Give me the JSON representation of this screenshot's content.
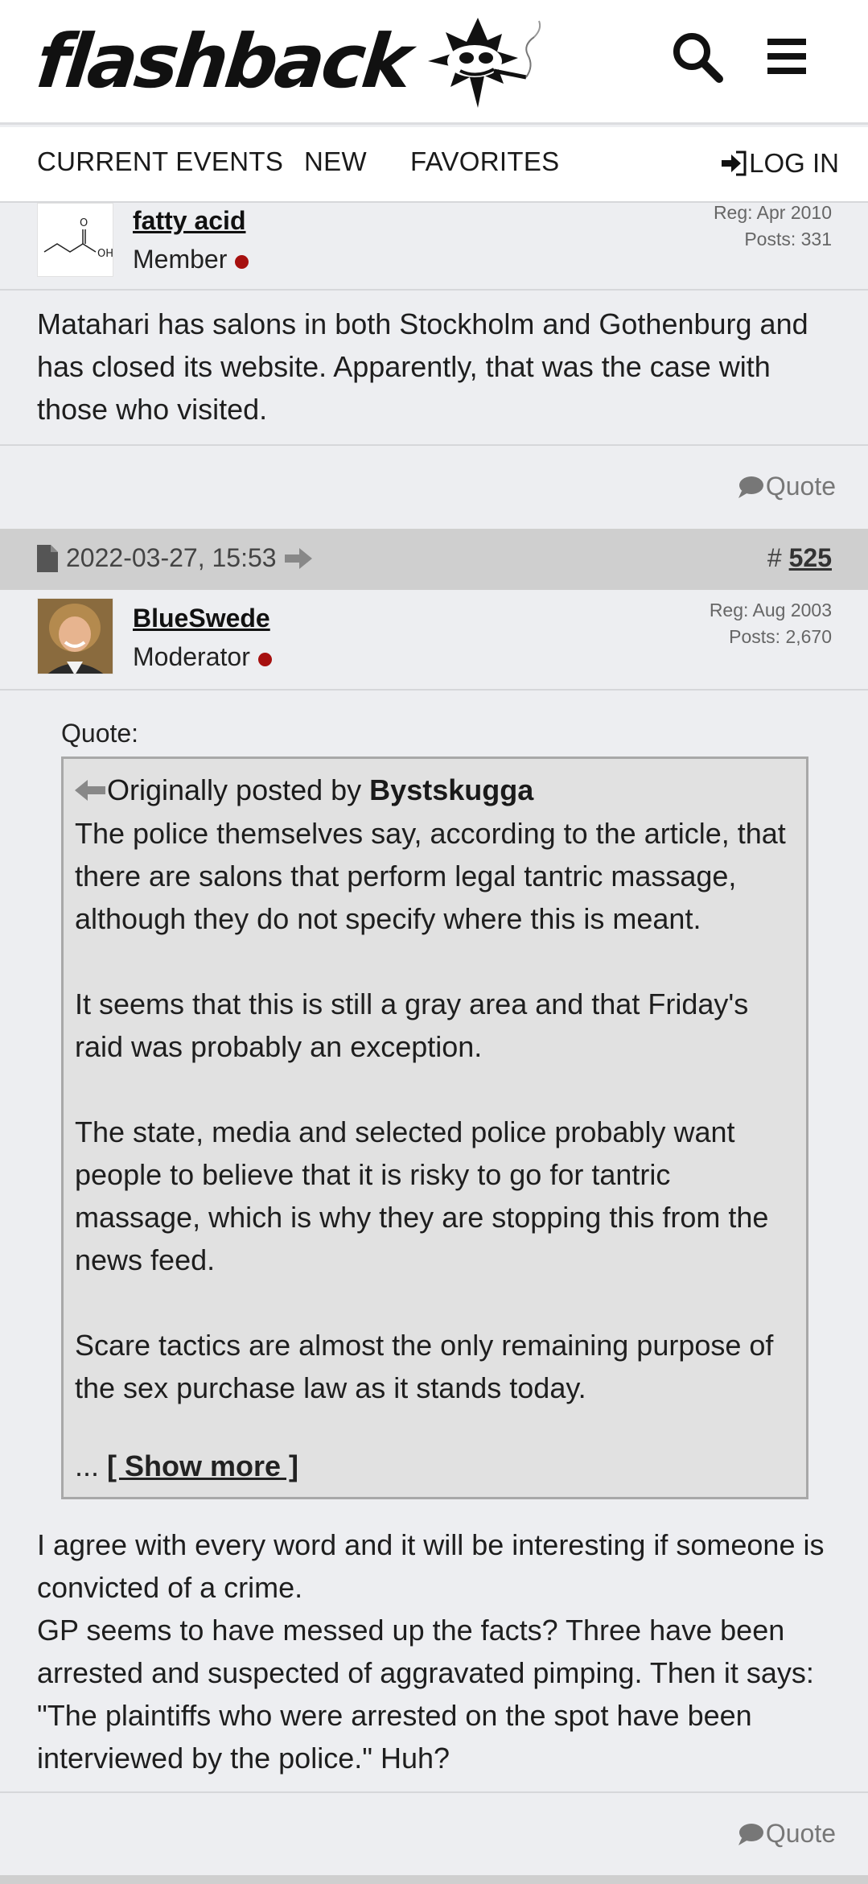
{
  "header": {
    "logo_text": "flashback",
    "search_icon": "search-icon",
    "menu_icon": "hamburger-menu-icon"
  },
  "nav": {
    "items": [
      "CURRENT EVENTS",
      "NEW",
      "FAVORITES"
    ],
    "login": "LOG IN"
  },
  "post1": {
    "username": "fatty acid",
    "role": "Member",
    "reg": "Reg: Apr 2010",
    "posts": "Posts: 331",
    "text": "Matahari has salons in both Stockholm and Gothenburg and has closed its website. Apparently, that was the case with those who visited.",
    "quote_label": "Quote"
  },
  "post2": {
    "date": "2022-03-27, 15:53",
    "number_prefix": "#",
    "number": "525",
    "username": "BlueSwede",
    "role": "Moderator",
    "reg": "Reg: Aug 2003",
    "posts": "Posts: 2,670",
    "quote": {
      "label": "Quote:",
      "origin_prefix": "Originally posted by",
      "origin_user": "Bystskugga",
      "paragraphs": [
        "The police themselves say, according to the article, that there are salons that perform legal tantric massage, although they do not specify where this is meant.",
        "It seems that this is still a gray area and that Friday's raid was probably an exception.",
        "The state, media and selected police probably want people to believe that it is risky to go for tantric massage, which is why they are stopping this from the news feed.",
        "Scare tactics are almost the only remaining purpose of the sex purchase law as it stands today."
      ],
      "ellipsis": "...",
      "show_more": "[ Show more ]"
    },
    "text_lines": [
      "I agree with every word and it will be interesting if someone is convicted of a crime.",
      "GP seems to have messed up the facts? Three have been arrested and suspected of aggravated pimping. Then it says: \"The plaintiffs who were arrested on the spot have been interviewed by the police.\" Huh?"
    ],
    "quote_label": "Quote"
  },
  "colors": {
    "online_dot": "#a6100f",
    "post_header_bg": "#cfcfcf",
    "page_bg": "#edeef1",
    "quote_box_bg": "#e1e1e1"
  }
}
